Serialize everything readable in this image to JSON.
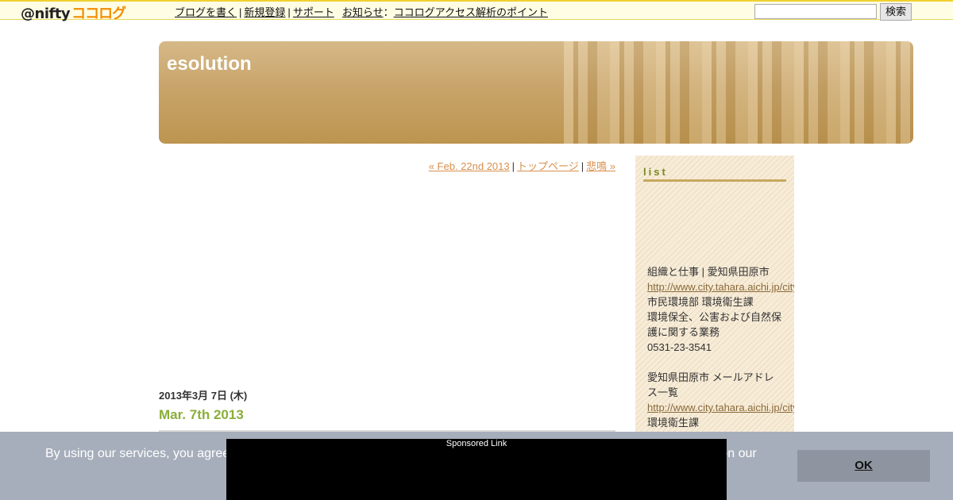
{
  "topbar": {
    "logo_at": "@nifty",
    "logo_coco": "ココログ",
    "nav": {
      "write": "ブログを書く",
      "register": "新規登録",
      "support": "サポート",
      "news_label": "お知らせ",
      "news_colon": "：",
      "news_link": "ココログアクセス解析のポイント"
    },
    "search": {
      "value": "",
      "button": "検索"
    }
  },
  "banner": {
    "title": "esolution"
  },
  "post_nav": {
    "prev": "« Feb. 22nd 2013",
    "top": "トップページ",
    "next": "悲鳴 »",
    "separator": "|"
  },
  "entry": {
    "date": "2013年3月 7日 (木)",
    "title": "Mar. 7th 2013"
  },
  "sidebar": {
    "title": "list",
    "lines": [
      {
        "text": "組織と仕事 | 愛知県田原市",
        "link": false
      },
      {
        "text": "http://www.city.tahara.aichi.jp/city/",
        "link": true
      },
      {
        "text": "市民環境部 環境衛生課",
        "link": false
      },
      {
        "text": "環境保全、公害および自然保",
        "link": false
      },
      {
        "text": "護に関する業務",
        "link": false
      },
      {
        "text": "0531-23-3541",
        "link": false
      },
      {
        "text": "",
        "link": false
      },
      {
        "text": "愛知県田原市 メールアドレ",
        "link": false
      },
      {
        "text": "ス一覧",
        "link": false
      },
      {
        "text": "http://www.city.tahara.aichi.jp/city/",
        "link": true
      },
      {
        "text": "環境衛生課",
        "link": false
      }
    ]
  },
  "cookie": {
    "text_left": "By using our services, you agree",
    "text_right": "ce on our",
    "ok": "OK"
  },
  "ad": {
    "label": "Sponsored Link"
  },
  "colors": {
    "accent_link": "#d98f4a",
    "entry_title": "#8aae3a",
    "banner": "#c8a46a",
    "cookie_bg": "#a6aebb"
  }
}
